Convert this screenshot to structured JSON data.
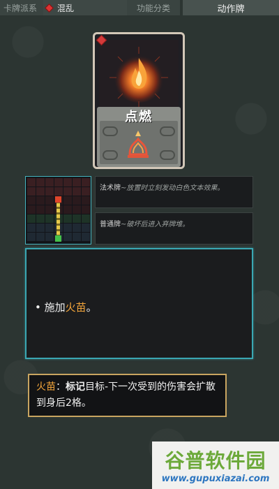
{
  "filter_bar": {
    "faction_label": "卡牌派系",
    "faction_value": "混乱",
    "category_label": "功能分类",
    "category_value": "动作牌"
  },
  "card": {
    "name": "点燃",
    "gem_color": "#d43a3a"
  },
  "types": [
    {
      "name": "法术牌",
      "desc": "~放置时立刻发动白色文本效果。"
    },
    {
      "name": "普通牌",
      "desc": "~破坏后进入弃牌堆。"
    }
  ],
  "effect": {
    "bullet": "•",
    "prefix": "施加",
    "keyword": "火苗",
    "suffix": "。"
  },
  "tooltip": {
    "keyword": "火苗",
    "colon": "：",
    "tag": "标记",
    "text": "目标-下一次受到的伤害会扩散到身后2格。"
  },
  "watermark": {
    "brand": "谷普软件园",
    "url": "www.gupuxiazai.com"
  },
  "colors": {
    "accent_cyan": "#3aa7b3",
    "keyword_orange": "#f3a53b",
    "tooltip_border": "#c9a560"
  }
}
